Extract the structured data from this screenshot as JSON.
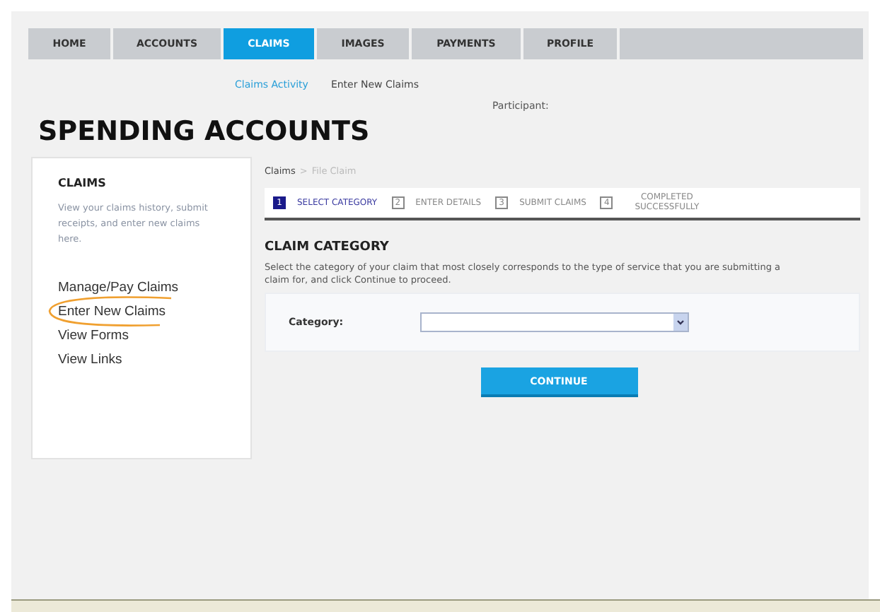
{
  "nav_tabs": [
    {
      "label": "HOME",
      "selected": false
    },
    {
      "label": "ACCOUNTS",
      "selected": false
    },
    {
      "label": "CLAIMS",
      "selected": true
    },
    {
      "label": "IMAGES",
      "selected": false
    },
    {
      "label": "PAYMENTS",
      "selected": false
    },
    {
      "label": "PROFILE",
      "selected": false
    }
  ],
  "sub_nav": [
    {
      "label": "Claims Activity",
      "selected": false
    },
    {
      "label": "Enter New Claims",
      "selected": true
    }
  ],
  "participant_label": "Participant:",
  "page_title": "SPENDING ACCOUNTS",
  "sidebar": {
    "title": "CLAIMS",
    "description": "View your claims history, submit receipts, and enter new claims here.",
    "links": [
      {
        "label": "Manage/Pay Claims",
        "highlighted": false
      },
      {
        "label": "Enter New Claims",
        "highlighted": true
      },
      {
        "label": "View Forms",
        "highlighted": false
      },
      {
        "label": "View Links",
        "highlighted": false
      }
    ]
  },
  "breadcrumb": [
    {
      "label": "Claims"
    },
    {
      "label": ">"
    },
    {
      "label": "File Claim"
    }
  ],
  "steps": [
    {
      "number": "1",
      "label": "SELECT CATEGORY",
      "selected": true
    },
    {
      "number": "2",
      "label": "ENTER DETAILS",
      "selected": false
    },
    {
      "number": "3",
      "label": "SUBMIT CLAIMS",
      "selected": false
    },
    {
      "number": "4",
      "label": "COMPLETED SUCCESSFULLY",
      "selected": false
    }
  ],
  "section": {
    "title": "CLAIM CATEGORY",
    "description": "Select the category of your claim that most closely corresponds to the type of service that you are submitting a claim for, and click Continue to proceed.",
    "field_label": "Category:",
    "button": "CONTINUE"
  }
}
